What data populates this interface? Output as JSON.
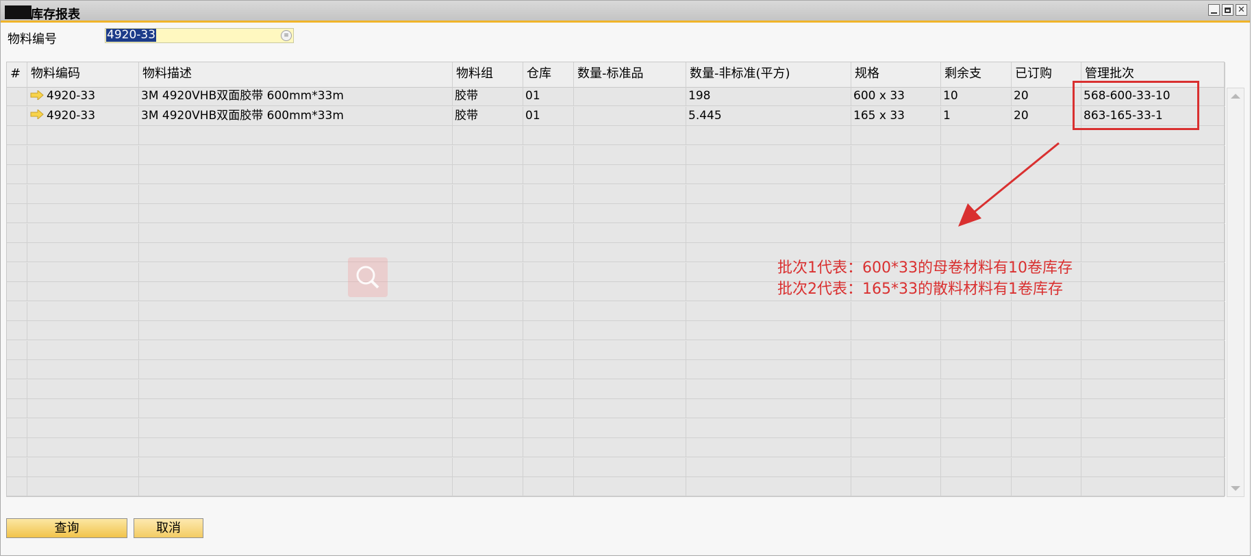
{
  "window": {
    "title": "库存报表"
  },
  "filter": {
    "label": "物料编号",
    "value": "4920-33"
  },
  "table": {
    "columns": [
      "#",
      "物料编码",
      "物料描述",
      "物料组",
      "仓库",
      "数量-标准品",
      "数量-非标准(平方)",
      "规格",
      "剩余支",
      "已订购",
      "管理批次"
    ],
    "rows": [
      {
        "code": "4920-33",
        "desc": "3M 4920VHB双面胶带 600mm*33m",
        "group": "胶带",
        "warehouse": "01",
        "qty_std": "",
        "qty_nonstd": "198",
        "spec": "600 x 33",
        "remaining": "10",
        "ordered": "20",
        "batch": "568-600-33-10"
      },
      {
        "code": "4920-33",
        "desc": "3M 4920VHB双面胶带 600mm*33m",
        "group": "胶带",
        "warehouse": "01",
        "qty_std": "",
        "qty_nonstd": "5.445",
        "spec": "165 x 33",
        "remaining": "1",
        "ordered": "20",
        "batch": "863-165-33-1"
      }
    ]
  },
  "annotation": {
    "line1": "批次1代表：600*33的母卷材料有10卷库存",
    "line2": "批次2代表：165*33的散料材料有1卷库存",
    "color": "#d93030"
  },
  "buttons": {
    "query": "查询",
    "cancel": "取消"
  }
}
